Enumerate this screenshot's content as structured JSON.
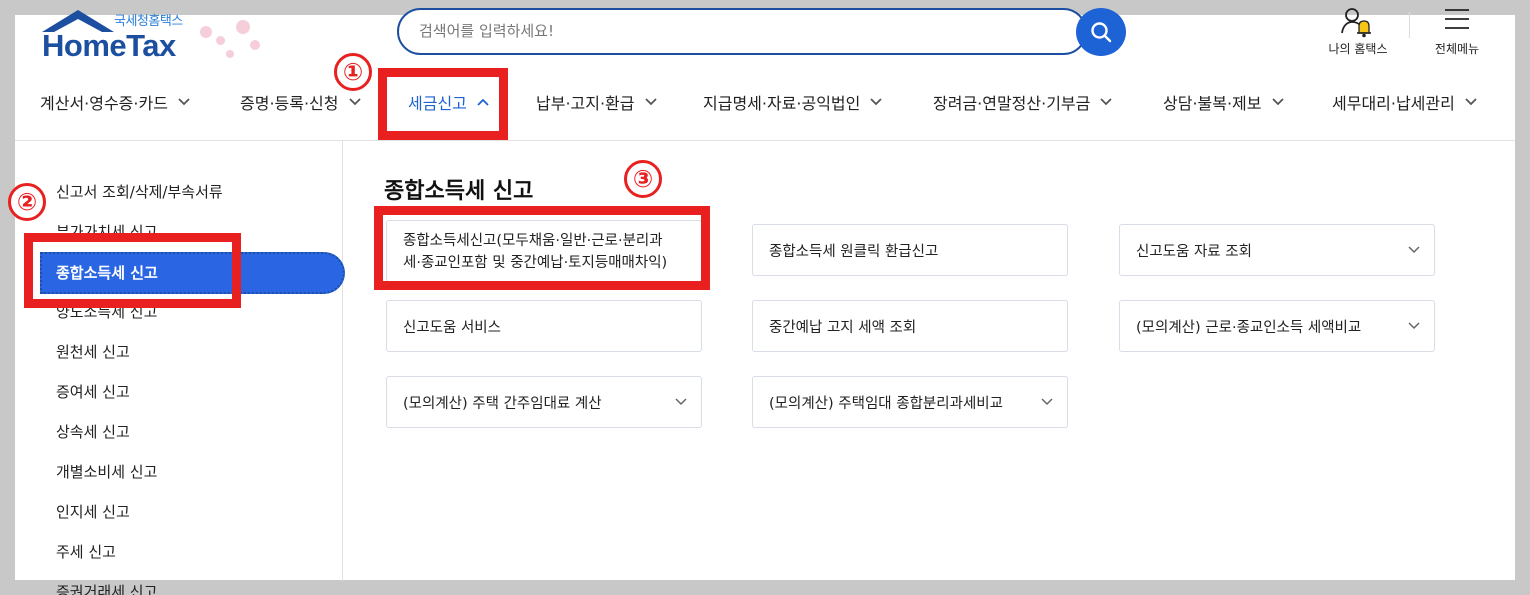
{
  "header": {
    "logo_sub": "국세청홈택스",
    "logo_main": "HomeTax",
    "search_placeholder": "검색어를 입력하세요!",
    "my_hometax": "나의 홈택스",
    "all_menu": "전체메뉴"
  },
  "nav": {
    "items": [
      {
        "label": "계산서·영수증·카드"
      },
      {
        "label": "증명·등록·신청"
      },
      {
        "label": "세금신고"
      },
      {
        "label": "납부·고지·환급"
      },
      {
        "label": "지급명세·자료·공익법인"
      },
      {
        "label": "장려금·연말정산·기부금"
      },
      {
        "label": "상담·불복·제보"
      },
      {
        "label": "세무대리·납세관리"
      }
    ],
    "active_index": 2
  },
  "sidebar": {
    "items": [
      {
        "label": "신고서 조회/삭제/부속서류"
      },
      {
        "label": "부가가치세 신고"
      },
      {
        "label": "종합소득세 신고",
        "active": true
      },
      {
        "label": "양도소득세 신고"
      },
      {
        "label": "원천세 신고"
      },
      {
        "label": "증여세 신고"
      },
      {
        "label": "상속세 신고"
      },
      {
        "label": "개별소비세 신고"
      },
      {
        "label": "인지세 신고"
      },
      {
        "label": "주세 신고"
      },
      {
        "label": "증권거래세 신고"
      }
    ]
  },
  "main": {
    "title": "종합소득세 신고",
    "cards": [
      {
        "line1": "종합소득세신고(모두채움·일반·근로·분리과",
        "line2": "세·종교인포함 및 중간예납·토지등매매차익)",
        "has_dropdown": false
      },
      {
        "label": "종합소득세 원클릭 환급신고",
        "has_dropdown": false
      },
      {
        "label": "신고도움 자료 조회",
        "has_dropdown": true
      },
      {
        "label": "신고도움 서비스",
        "has_dropdown": false
      },
      {
        "label": "중간예납 고지 세액 조회",
        "has_dropdown": false
      },
      {
        "label": "(모의계산) 근로·종교인소득 세액비교",
        "has_dropdown": true
      },
      {
        "label": "(모의계산) 주택 간주임대료 계산",
        "has_dropdown": true
      },
      {
        "label": "(모의계산) 주택임대 종합분리과세비교",
        "has_dropdown": true
      }
    ]
  },
  "annotations": {
    "num1": "①",
    "num2": "②",
    "num3": "③",
    "color": "#e82020"
  },
  "colors": {
    "brand": "#1c4fa0",
    "accent": "#1e63d6",
    "active_sidebar": "#2a66e3"
  }
}
